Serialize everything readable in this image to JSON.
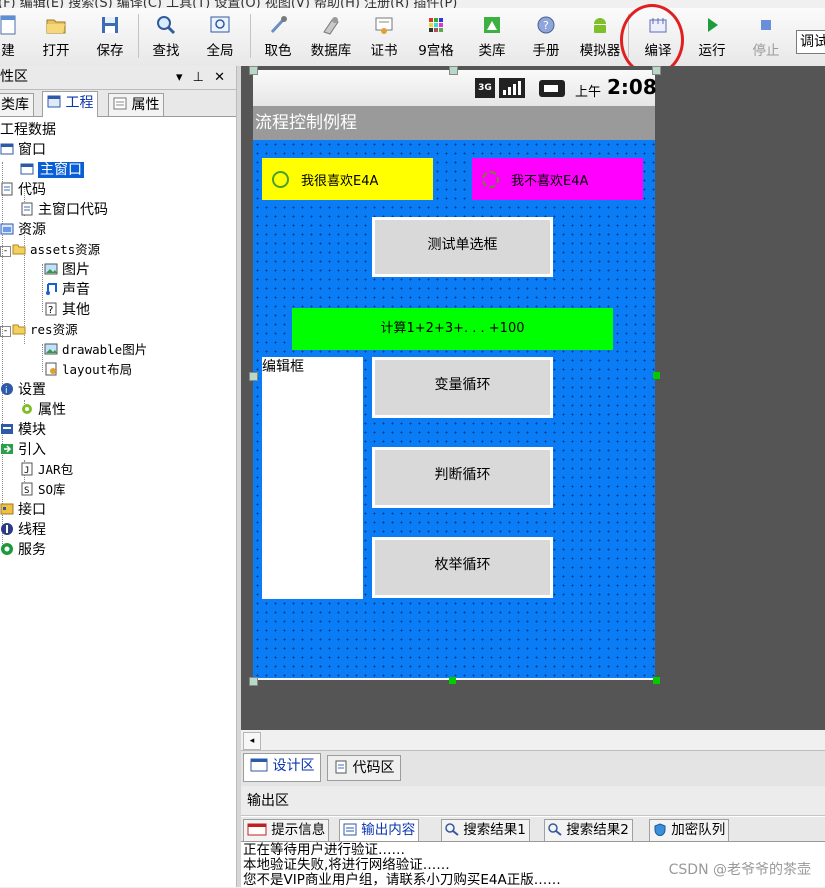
{
  "menubar": {
    "text": "(F)  编辑(E)  搜索(S)  编译(C)  工具(T)  设置(O)  视图(V)  帮助(H)  注册(R)  插件(P)"
  },
  "toolbar": {
    "new": "建",
    "open": "打开",
    "save": "保存",
    "find": "查找",
    "global": "全局",
    "pick_color": "取色",
    "database": "数据库",
    "cert": "证书",
    "grid9": "9宫格",
    "library": "类库",
    "manual": "手册",
    "emulator": "模拟器",
    "compile": "编译",
    "run": "运行",
    "stop": "停止",
    "debug_box": "调试"
  },
  "left": {
    "header": "性区",
    "header_icons": "▾ ⊥ ✕",
    "tabs": [
      "类库",
      "工程",
      "属性"
    ],
    "tree": {
      "project_data": "工程数据",
      "window": "窗口",
      "main_window": "主窗口",
      "code": "代码",
      "main_window_code": "主窗口代码",
      "resources": "资源",
      "assets": "assets资源",
      "images": "图片",
      "sound": "声音",
      "other": "其他",
      "res": "res资源",
      "drawable": "drawable图片",
      "layout": "layout布局",
      "settings": "设置",
      "properties": "属性",
      "modules": "模块",
      "imports": "引入",
      "jar": "JAR包",
      "so": "SO库",
      "interfaces": "接口",
      "threads": "线程",
      "services": "服务"
    }
  },
  "phone": {
    "status": {
      "ampm": "上午",
      "time": "2:08",
      "network": "3G"
    },
    "title": "流程控制例程",
    "radio1": "我很喜欢E4A",
    "radio2": "我不喜欢E4A",
    "btn_test_radio": "测试单选框",
    "btn_sum": "计算1+2+3+. . . +100",
    "editbox": "编辑框",
    "btn_var_loop": "变量循环",
    "btn_cond_loop": "判断循环",
    "btn_enum_loop": "枚举循环"
  },
  "design_tabs": [
    "设计区",
    "代码区"
  ],
  "output": {
    "header": "输出区",
    "tabs": [
      "提示信息",
      "输出内容",
      "搜索结果1",
      "搜索结果2",
      "加密队列"
    ],
    "lines": [
      "正在等待用户进行验证……",
      "本地验证失败,将进行网络验证……",
      "您不是VIP商业用户组，请联系小刀购买E4A正版……"
    ]
  },
  "watermark": "CSDN @老爷爷的茶壶",
  "colors": {
    "canvas_blue": "#0a7cf6",
    "radio1_bg": "#ffff00",
    "radio2_bg": "#ff00ff",
    "sum_btn_bg": "#00ff00",
    "highlight_circle": "#e02020",
    "selection": "#0a5fd6"
  }
}
